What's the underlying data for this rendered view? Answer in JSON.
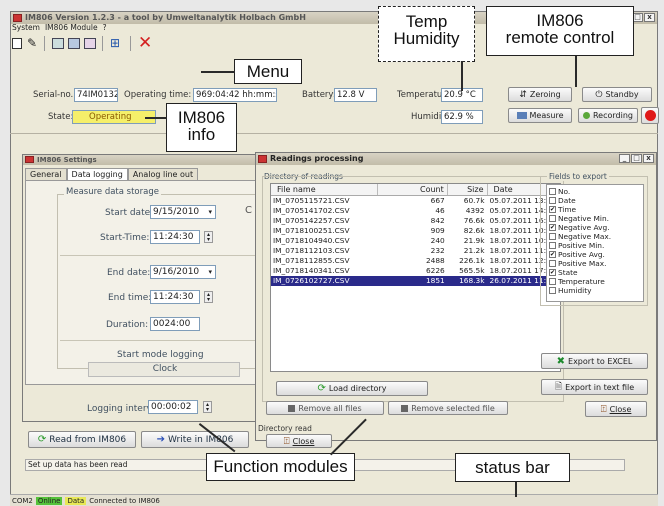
{
  "main_window": {
    "title": "IM806 Version 1.2.3  - a tool by Umweltanalytik Holbach GmbH",
    "menu": [
      "System",
      "IM806 Module",
      "?"
    ],
    "serial_label": "Serial-no.:",
    "serial_value": "74IM0132",
    "operating_time_label": "Operating time:",
    "operating_time_value": "969:04:42",
    "operating_time_unit": "hh:mm:ss",
    "battery_label": "Battery:",
    "battery_value": "12.8 V",
    "temperature_label": "Temperature",
    "temperature_value": "20.9 °C",
    "humidity_label": "Humidity",
    "humidity_value": "62.9 %",
    "state_label": "State:",
    "state_value": "Operating",
    "buttons": {
      "zeroing": "Zeroing",
      "standby": "Standby",
      "measure": "Measure",
      "recording": "Recording"
    },
    "read_button": "Read from IM806",
    "write_button": "Write in IM806",
    "status_message": "Set up data has been read",
    "statusbar": {
      "port": "COM2",
      "online": "Online",
      "data": "Data",
      "message": "Connected to IM806"
    }
  },
  "settings_window": {
    "title": "IM806 Settings",
    "tabs": [
      "General",
      "Data logging",
      "Analog line out"
    ],
    "group_title": "Measure data storage",
    "start_date_label": "Start date:",
    "start_date_value": "9/15/2010",
    "start_time_label": "Start-Time:",
    "start_time_value": "11:24:30",
    "end_date_label": "End date:",
    "end_date_value": "9/16/2010",
    "end_time_label": "End time:",
    "end_time_value": "11:24:30",
    "duration_label": "Duration:",
    "duration_value": "0024:00",
    "start_mode_label": "Start mode logging",
    "start_mode_value": "Clock",
    "logging_interval_label": "Logging interval:",
    "logging_interval_value": "00:00:02"
  },
  "readings_window": {
    "title": "Readings processing",
    "directory_label": "Directory of readings",
    "columns": [
      "File name",
      "Count",
      "Size",
      "Date"
    ],
    "rows": [
      {
        "name": "IM_0705115721.CSV",
        "count": "667",
        "size": "60.7k",
        "date": "05.07.2011 13:4"
      },
      {
        "name": "IM_0705141702.CSV",
        "count": "46",
        "size": "4392",
        "date": "05.07.2011 14:1"
      },
      {
        "name": "IM_0705142257.CSV",
        "count": "842",
        "size": "76.6k",
        "date": "05.07.2011 16:5"
      },
      {
        "name": "IM_0718100251.CSV",
        "count": "909",
        "size": "82.6k",
        "date": "18.07.2011 10:3"
      },
      {
        "name": "IM_0718104940.CSV",
        "count": "240",
        "size": "21.9k",
        "date": "18.07.2011 10:5"
      },
      {
        "name": "IM_0718112103.CSV",
        "count": "232",
        "size": "21.2k",
        "date": "18.07.2011 11:2"
      },
      {
        "name": "IM_0718112855.CSV",
        "count": "2488",
        "size": "226.1k",
        "date": "18.07.2011 12:5"
      },
      {
        "name": "IM_0718140341.CSV",
        "count": "6226",
        "size": "565.5k",
        "date": "18.07.2011 17:3"
      },
      {
        "name": "IM_0726102727.CSV",
        "count": "1851",
        "size": "168.3k",
        "date": "26.07.2011 11:2"
      }
    ],
    "fields_label": "Fields to export",
    "fields": [
      {
        "label": "No.",
        "checked": false
      },
      {
        "label": "Date",
        "checked": false
      },
      {
        "label": "Time",
        "checked": true
      },
      {
        "label": "Negative Min.",
        "checked": false
      },
      {
        "label": "Negative Avg.",
        "checked": true
      },
      {
        "label": "Negative Max.",
        "checked": false
      },
      {
        "label": "Positive Min.",
        "checked": false
      },
      {
        "label": "Positive Avg.",
        "checked": true
      },
      {
        "label": "Positive Max.",
        "checked": false
      },
      {
        "label": "State",
        "checked": true
      },
      {
        "label": "Temperature",
        "checked": false
      },
      {
        "label": "Humidity",
        "checked": false
      }
    ],
    "load_button": "Load directory",
    "export_excel_button": "Export to EXCEL",
    "export_text_button": "Export in text file",
    "close_button": "Close",
    "remove_all_button": "Remove all files",
    "remove_selected_button": "Remove selected file",
    "close_button_2": "Close",
    "status_text": "Directory read"
  },
  "annotations": {
    "menu": "Menu",
    "temp_humidity_1": "Temp",
    "temp_humidity_2": "Humidity",
    "remote_1": "IM806",
    "remote_2": "remote control",
    "info_1": "IM806",
    "info_2": "info",
    "function_modules": "Function modules",
    "status_bar": "status bar"
  },
  "colors": {
    "state_highlight": "#f5ef6a",
    "online": "#55c23a",
    "data": "#e8e855",
    "selection": "#2a2a8a",
    "close_red": "#d42020"
  }
}
